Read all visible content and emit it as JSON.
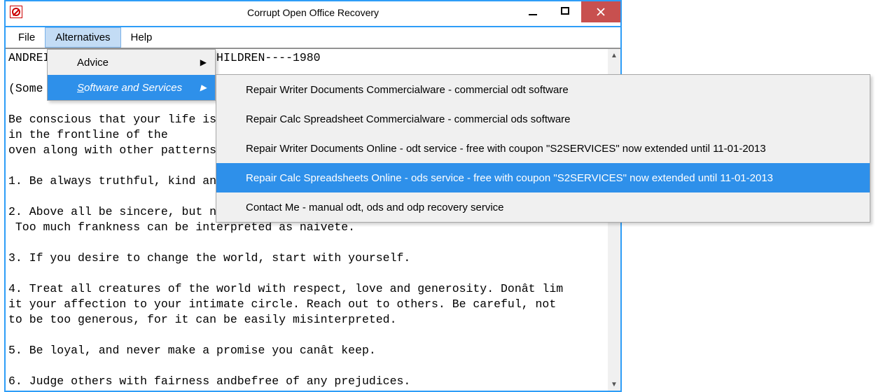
{
  "window": {
    "title": "Corrupt Open Office Recovery"
  },
  "menubar": {
    "file": "File",
    "alternatives": "Alternatives",
    "help": "Help"
  },
  "dropdown1": {
    "advice": "Advice",
    "software_prefix": "S",
    "software_rest": "oftware and Services"
  },
  "dropdown2": {
    "item1": "Repair Writer Documents Commercialware - commercial odt software",
    "item2": "Repair Calc Spreadsheet Commercialware - commercial ods software",
    "item3": "Repair Writer Documents Online - odt service - free with coupon \"S2SERVICES\" now extended until 11-01-2013",
    "item4": "Repair Calc Spreadsheets Online - ods service - free with coupon \"S2SERVICES\" now extended until 11-01-2013",
    "item5": "Contact Me - manual odt, ods and odp recovery service"
  },
  "document": {
    "text": "ANDREI SAKHAROV----ADVICE TO CHILDREN----1980\n\n(Some of the following advice has been summarized)\n\nBe conscious that your life is not only yours but of your loved ones, so donât put it in the frontline of the\noven along with other patterns, but only in situations where there is no other choice.\n\n1. Be always truthful, kind and merciful.\n\n2. Above all be sincere, but not too much that you cannot be discreet.\n Too much frankness can be interpreted as naivete.\n\n3. If you desire to change the world, start with yourself.\n\n4. Treat all creatures of the world with respect, love and generosity. Donât lim\nit your affection to your intimate circle. Reach out to others. Be careful, not\nto be too generous, for it can be easily misinterpreted.\n\n5. Be loyal, and never make a promise you canât keep.\n\n6. Judge others with fairness andbefree of any prejudices."
  }
}
